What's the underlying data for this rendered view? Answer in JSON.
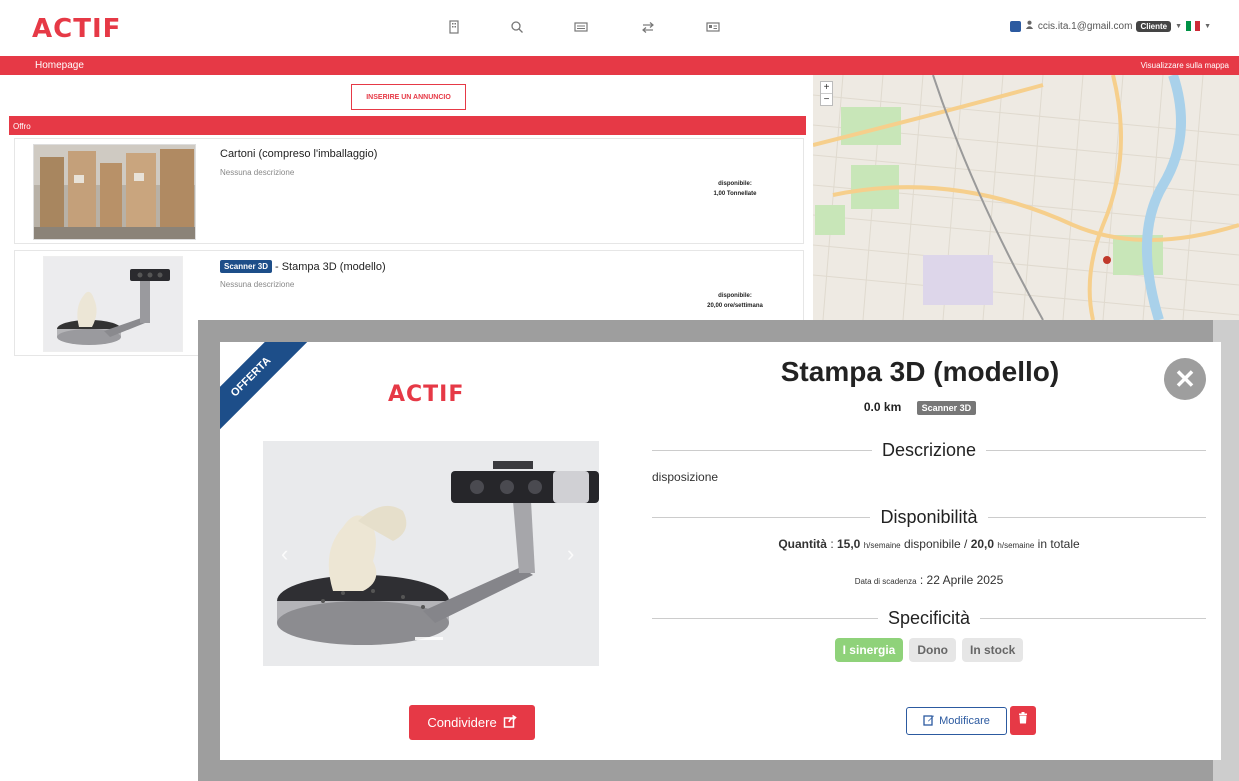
{
  "nav": {
    "logo": "ACTIF",
    "user_email": "ccis.ita.1@gmail.com",
    "role_badge": "Cliente",
    "icons": [
      "building-icon",
      "search-icon",
      "list-icon",
      "exchange-icon",
      "id-card-icon"
    ]
  },
  "breadcrumb": {
    "home": "Homepage",
    "map_link": "Visualizzare sulla mappa"
  },
  "listing": {
    "insert_button": "INSERIRE UN ANNUNCIO",
    "section_title": "Offro",
    "items": [
      {
        "title": "Cartoni (compreso l'imballaggio)",
        "tag": "",
        "description": "Nessuna descrizione",
        "avail_label": "disponibile:",
        "avail_value": "1,00 Tonnellate"
      },
      {
        "title": "Stampa 3D (modello)",
        "tag": "Scanner 3D",
        "title_separator": "-",
        "description": "Nessuna descrizione",
        "avail_label": "disponibile:",
        "avail_value": "20,00 ore/settimana"
      }
    ]
  },
  "map": {
    "zoom_in": "+",
    "zoom_out": "−"
  },
  "modal": {
    "ribbon": "OFFERTA",
    "logo": "ACTIF",
    "title": "Stampa 3D (modello)",
    "distance": "0.0 km",
    "tag": "Scanner 3D",
    "close": "✕",
    "description_header": "Descrizione",
    "description": "disposizione",
    "availability_header": "Disponibilità",
    "quantity_label": "Quantità",
    "quantity_sep": " : ",
    "available_amount": "15,0",
    "unit": "h/semaine",
    "available_word": "disponibile /",
    "total_amount": "20,0",
    "total_word": "in totale",
    "expiry_label": "Data di scadenza",
    "expiry_value": ": 22 Aprile 2025",
    "specs_header": "Specificità",
    "chips": [
      "I sinergia",
      "Dono",
      "In stock"
    ],
    "share_button": "Condividere",
    "edit_button": "Modificare"
  },
  "colors": {
    "brand_red": "#e63946",
    "brand_blue": "#1d4e89",
    "chip_green": "#8fd27a"
  }
}
